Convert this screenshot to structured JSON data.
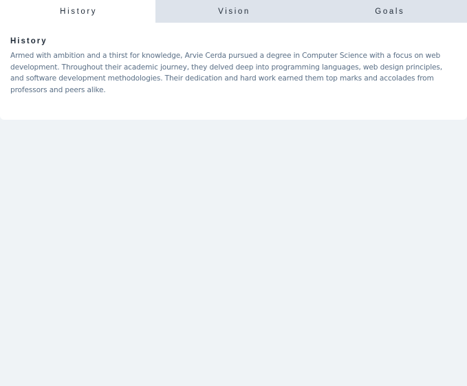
{
  "tabs": [
    {
      "label": "History",
      "active": true
    },
    {
      "label": "Vision",
      "active": false
    },
    {
      "label": "Goals",
      "active": false
    }
  ],
  "panel": {
    "title": "History",
    "body": "Armed with ambition and a thirst for knowledge, Arvie Cerda pursued a degree in Computer Science with a focus on web development. Throughout their academic journey, they delved deep into programming languages, web design principles, and software development methodologies. Their dedication and hard work earned them top marks and accolades from professors and peers alike."
  },
  "colors": {
    "page_background": "#eff3f6",
    "tab_bar_background": "#dde3eb",
    "active_tab_background": "#ffffff",
    "heading_text": "#1f2a37",
    "body_text": "#5a6f86"
  }
}
